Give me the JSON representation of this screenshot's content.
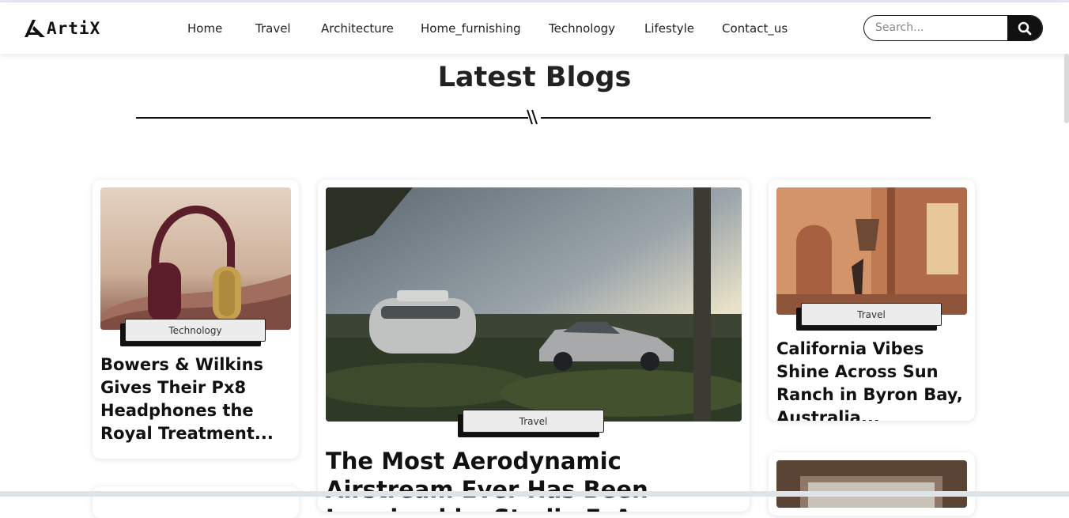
{
  "brand": {
    "name": "ArtiX"
  },
  "nav": {
    "items": [
      {
        "label": "Home"
      },
      {
        "label": "Travel"
      },
      {
        "label": "Architecture"
      },
      {
        "label": "Home_furnishing"
      },
      {
        "label": "Technology"
      },
      {
        "label": "Lifestyle"
      },
      {
        "label": "Contact_us"
      }
    ]
  },
  "search": {
    "placeholder": "Search...",
    "icon": "search-icon"
  },
  "section": {
    "title": "Latest Blogs"
  },
  "posts": [
    {
      "category": "Technology",
      "title": "Bowers & Wilkins Gives Their Px8 Headphones the Royal Treatment...",
      "image": "headphones"
    },
    {
      "category": "Travel",
      "title": "The Most Aerodynamic Airstream Ever Has Been Imagined by Studio F. A",
      "image": "airstream-camper-and-car"
    },
    {
      "category": "Travel",
      "title": "California Vibes Shine Across Sun Ranch in Byron Bay, Australia...",
      "image": "interior-room"
    }
  ],
  "colors": {
    "accent": "#111111",
    "badge_bg": "#ececec"
  }
}
